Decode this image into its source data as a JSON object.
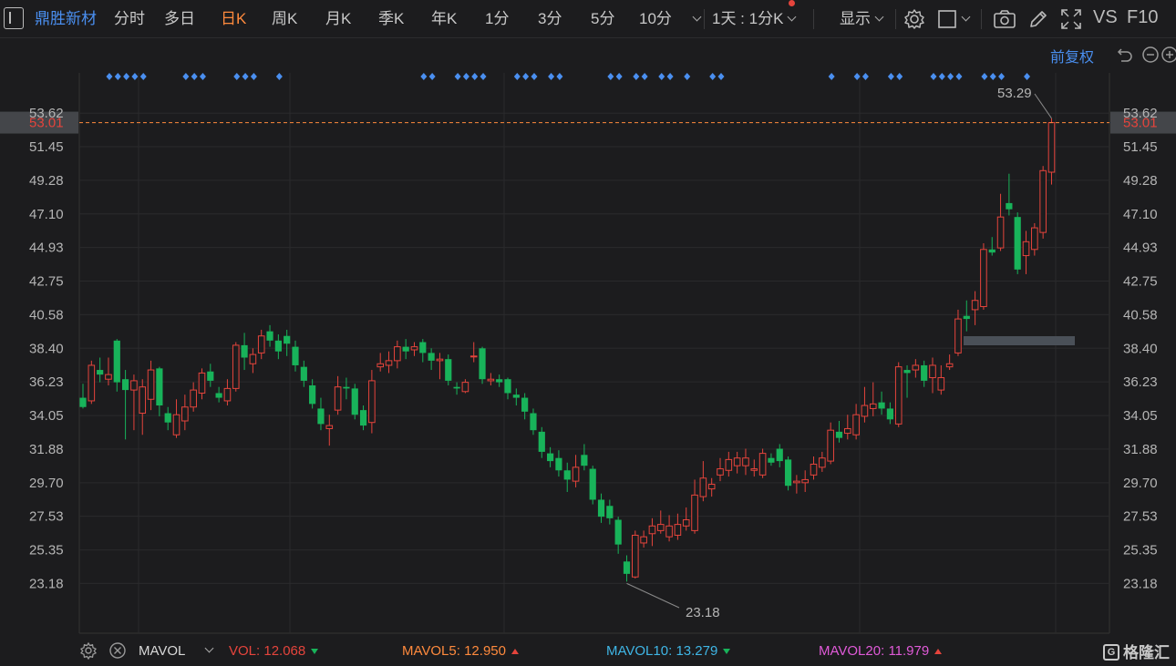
{
  "toolbar": {
    "stock_name": "鼎胜新材",
    "periods": [
      "分时",
      "多日",
      "日K",
      "周K",
      "月K",
      "季K",
      "年K",
      "1分",
      "3分",
      "5分",
      "10分"
    ],
    "active_period": "日K",
    "multi_period": "1天 : 1分K",
    "display": "显示",
    "vs": "VS",
    "f10": "F10"
  },
  "adjust_label": "前复权",
  "icons": [
    "sidebar-toggle-icon",
    "chevron-down-icon",
    "gear-icon",
    "square-icon",
    "camera-icon",
    "pencil-icon",
    "fullscreen-icon",
    "undo-icon",
    "minus-circle-icon",
    "plus-circle-icon"
  ],
  "y_axis": {
    "ticks": [
      "53.62",
      "51.45",
      "49.28",
      "47.10",
      "44.93",
      "42.75",
      "40.58",
      "38.40",
      "36.23",
      "34.05",
      "31.88",
      "29.70",
      "27.53",
      "25.35",
      "23.18"
    ],
    "current_price": "53.01"
  },
  "annotations": {
    "high": "53.29",
    "low": "23.18"
  },
  "bottom": {
    "indicator": "MAVOL",
    "vol_label": "VOL:",
    "vol_value": "12.068",
    "mavol5_label": "MAVOL5:",
    "mavol5_value": "12.950",
    "mavol10_label": "MAVOL10:",
    "mavol10_value": "13.279",
    "mavol20_label": "MAVOL20:",
    "mavol20_value": "11.979",
    "logo_text": "格隆汇"
  },
  "colors": {
    "up": "#e5443c",
    "down": "#18b35a",
    "active": "#ff8a3d",
    "link": "#4a8ff0",
    "mavol5": "#ff8a3d",
    "mavol10": "#3fb6e6",
    "mavol20": "#e05ad8",
    "price_line": "#ff8a3d"
  },
  "chart_data": {
    "type": "candlestick",
    "ylim": [
      22.2,
      54.4
    ],
    "candles": [
      [
        35.2,
        34.6,
        36.1,
        34.5
      ],
      [
        35.0,
        37.3,
        37.6,
        34.8
      ],
      [
        37.0,
        36.7,
        37.8,
        36.2
      ],
      [
        36.4,
        36.7,
        37.8,
        36.0
      ],
      [
        38.9,
        36.2,
        39.0,
        35.6
      ],
      [
        36.4,
        35.7,
        37.0,
        32.5
      ],
      [
        35.7,
        36.3,
        36.7,
        33.1
      ],
      [
        34.2,
        35.9,
        36.4,
        32.8
      ],
      [
        35.1,
        37.0,
        37.6,
        34.4
      ],
      [
        37.1,
        34.7,
        37.2,
        34.0
      ],
      [
        34.2,
        33.6,
        34.6,
        33.1
      ],
      [
        32.8,
        34.1,
        35.1,
        32.6
      ],
      [
        33.7,
        34.6,
        35.4,
        33.1
      ],
      [
        34.6,
        35.7,
        36.2,
        34.3
      ],
      [
        35.5,
        36.8,
        37.1,
        35.1
      ],
      [
        36.9,
        36.3,
        37.4,
        35.9
      ],
      [
        35.5,
        35.2,
        35.9,
        34.9
      ],
      [
        35.0,
        35.8,
        36.4,
        34.7
      ],
      [
        35.8,
        38.6,
        38.8,
        35.6
      ],
      [
        38.6,
        37.8,
        39.4,
        37.0
      ],
      [
        37.4,
        38.0,
        38.4,
        36.8
      ],
      [
        38.1,
        39.2,
        39.6,
        37.7
      ],
      [
        39.5,
        38.9,
        39.9,
        38.5
      ],
      [
        38.9,
        38.2,
        39.3,
        37.7
      ],
      [
        39.2,
        38.7,
        39.6,
        37.9
      ],
      [
        38.5,
        37.3,
        38.9,
        36.9
      ],
      [
        37.2,
        36.3,
        37.6,
        35.9
      ],
      [
        36.0,
        34.8,
        36.4,
        34.5
      ],
      [
        34.5,
        33.5,
        35.2,
        33.1
      ],
      [
        33.2,
        33.4,
        34.1,
        32.1
      ],
      [
        34.4,
        35.9,
        36.6,
        34.1
      ],
      [
        35.9,
        35.8,
        36.5,
        35.1
      ],
      [
        35.8,
        34.1,
        36.1,
        33.8
      ],
      [
        34.4,
        33.4,
        34.7,
        33.1
      ],
      [
        33.6,
        36.3,
        37.0,
        32.9
      ],
      [
        37.2,
        37.4,
        38.1,
        36.9
      ],
      [
        37.3,
        37.6,
        38.2,
        36.8
      ],
      [
        37.6,
        38.5,
        38.9,
        37.1
      ],
      [
        38.5,
        38.2,
        39.0,
        37.7
      ],
      [
        38.3,
        38.5,
        38.8,
        37.9
      ],
      [
        38.8,
        38.1,
        39.0,
        37.5
      ],
      [
        38.1,
        37.6,
        38.4,
        37.0
      ],
      [
        37.6,
        37.7,
        38.1,
        36.4
      ],
      [
        37.7,
        36.3,
        38.0,
        36.0
      ],
      [
        35.9,
        35.8,
        36.2,
        35.4
      ],
      [
        35.6,
        36.2,
        36.4,
        35.5
      ],
      [
        37.9,
        37.9,
        38.8,
        37.5
      ],
      [
        38.4,
        36.4,
        38.5,
        36.1
      ],
      [
        36.3,
        36.4,
        36.8,
        36.0
      ],
      [
        36.4,
        36.2,
        36.7,
        35.9
      ],
      [
        36.4,
        35.5,
        36.5,
        35.1
      ],
      [
        35.4,
        35.2,
        35.8,
        34.7
      ],
      [
        35.2,
        34.3,
        35.5,
        33.8
      ],
      [
        34.2,
        33.1,
        34.5,
        32.8
      ],
      [
        33.0,
        31.7,
        33.3,
        31.3
      ],
      [
        31.6,
        31.1,
        32.0,
        30.7
      ],
      [
        31.3,
        30.5,
        31.8,
        30.1
      ],
      [
        30.5,
        29.9,
        31.0,
        29.1
      ],
      [
        29.8,
        30.7,
        31.5,
        29.4
      ],
      [
        31.5,
        30.8,
        32.2,
        30.5
      ],
      [
        30.6,
        28.6,
        30.8,
        28.3
      ],
      [
        28.6,
        27.5,
        29.0,
        27.1
      ],
      [
        28.2,
        27.4,
        28.6,
        27.0
      ],
      [
        27.3,
        25.7,
        27.5,
        25.1
      ],
      [
        24.6,
        23.8,
        25.0,
        23.3
      ],
      [
        23.6,
        26.3,
        26.6,
        23.5
      ],
      [
        25.8,
        26.2,
        26.6,
        25.5
      ],
      [
        26.4,
        26.9,
        27.4,
        25.6
      ],
      [
        26.6,
        27.0,
        27.9,
        26.4
      ],
      [
        26.2,
        26.9,
        27.6,
        25.9
      ],
      [
        26.3,
        27.0,
        27.7,
        26.0
      ],
      [
        26.9,
        27.3,
        28.1,
        26.6
      ],
      [
        26.6,
        28.9,
        29.9,
        26.4
      ],
      [
        28.8,
        30.0,
        31.1,
        28.5
      ],
      [
        29.3,
        29.6,
        30.0,
        28.8
      ],
      [
        30.2,
        30.6,
        31.3,
        29.8
      ],
      [
        30.5,
        31.2,
        31.7,
        30.1
      ],
      [
        30.8,
        31.3,
        31.7,
        30.3
      ],
      [
        30.8,
        31.3,
        31.9,
        30.2
      ],
      [
        30.5,
        30.6,
        31.2,
        30.1
      ],
      [
        30.2,
        31.6,
        31.9,
        30.0
      ],
      [
        31.3,
        31.0,
        31.6,
        30.8
      ],
      [
        31.9,
        31.1,
        32.2,
        30.7
      ],
      [
        31.2,
        29.5,
        31.4,
        29.2
      ],
      [
        29.7,
        29.8,
        30.2,
        29.0
      ],
      [
        29.7,
        29.9,
        30.5,
        29.1
      ],
      [
        30.2,
        30.9,
        31.4,
        29.9
      ],
      [
        30.7,
        31.3,
        31.7,
        30.4
      ],
      [
        31.1,
        33.1,
        33.6,
        30.9
      ],
      [
        33.0,
        32.6,
        33.7,
        32.3
      ],
      [
        32.9,
        33.2,
        34.1,
        32.5
      ],
      [
        32.8,
        34.1,
        34.8,
        32.5
      ],
      [
        34.0,
        34.7,
        35.9,
        33.6
      ],
      [
        34.5,
        34.8,
        36.2,
        34.0
      ],
      [
        34.9,
        34.5,
        35.6,
        34.1
      ],
      [
        34.5,
        33.8,
        34.9,
        33.5
      ],
      [
        33.5,
        37.2,
        37.5,
        33.3
      ],
      [
        37.0,
        36.8,
        37.3,
        35.2
      ],
      [
        37.0,
        37.3,
        37.7,
        36.5
      ],
      [
        37.3,
        36.3,
        37.6,
        35.9
      ],
      [
        36.5,
        37.3,
        37.8,
        35.5
      ],
      [
        35.7,
        36.5,
        37.3,
        35.4
      ],
      [
        37.2,
        37.4,
        38.0,
        37.0
      ],
      [
        38.1,
        40.3,
        40.9,
        37.9
      ],
      [
        40.5,
        40.3,
        41.5,
        39.5
      ],
      [
        40.9,
        41.5,
        42.1,
        39.9
      ],
      [
        41.1,
        44.8,
        45.2,
        40.9
      ],
      [
        44.8,
        44.6,
        45.6,
        44.4
      ],
      [
        44.9,
        46.9,
        48.4,
        44.7
      ],
      [
        47.8,
        47.4,
        49.7,
        47.0
      ],
      [
        46.9,
        43.5,
        47.2,
        43.2
      ],
      [
        44.4,
        45.3,
        46.0,
        43.2
      ],
      [
        44.8,
        46.2,
        46.5,
        44.4
      ],
      [
        45.9,
        49.9,
        50.2,
        45.5
      ],
      [
        49.8,
        53.01,
        53.29,
        49.0
      ]
    ]
  }
}
